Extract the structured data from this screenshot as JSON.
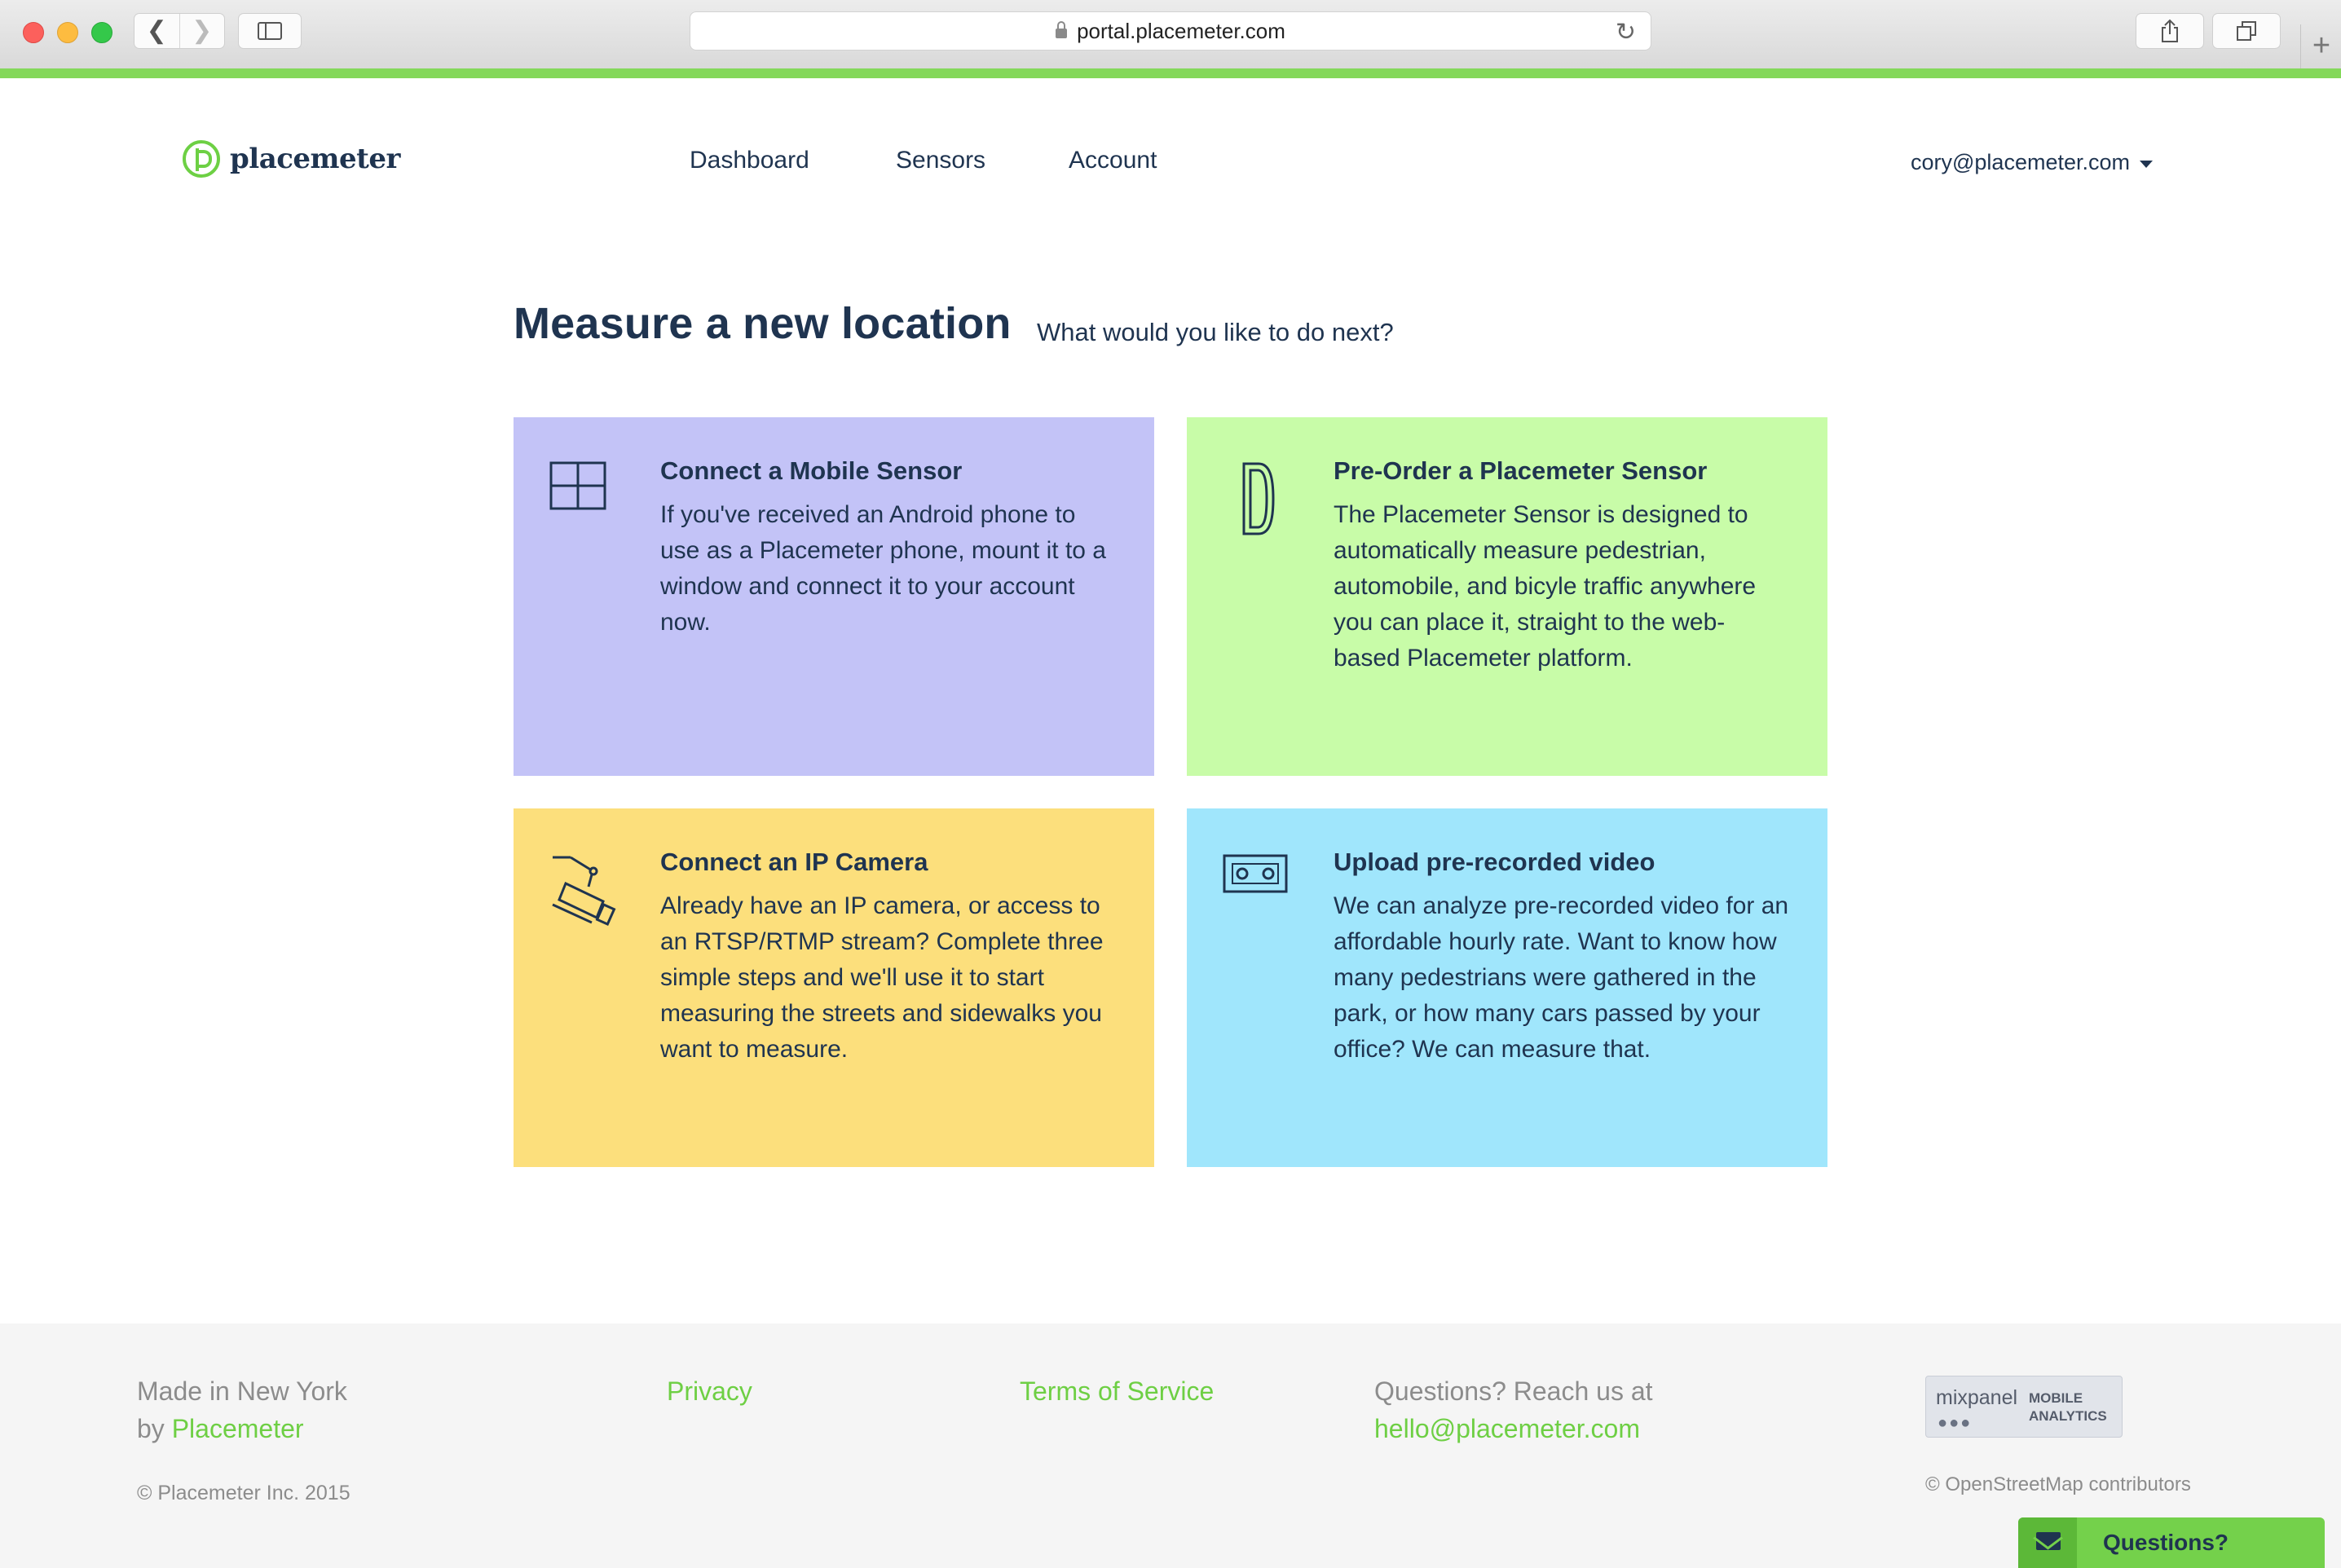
{
  "browser": {
    "url": "portal.placemeter.com",
    "back_glyph": "❮",
    "forward_glyph": "❯",
    "reload_glyph": "↻",
    "new_tab_glyph": "+"
  },
  "header": {
    "logo_text": "placemeter",
    "nav": [
      {
        "label": "Dashboard"
      },
      {
        "label": "Sensors"
      },
      {
        "label": "Account"
      }
    ],
    "user_email": "cory@placemeter.com"
  },
  "main": {
    "title": "Measure a new location",
    "subtitle": "What would you like to do next?",
    "cards": [
      {
        "title": "Connect a Mobile Sensor",
        "body": "If you've received an Android phone to use as a Placemeter phone, mount it to a window and connect it to your account now.",
        "color": "#c3c3f7",
        "icon": "window-icon"
      },
      {
        "title": "Pre-Order a Placemeter Sensor",
        "body": "The Placemeter Sensor is designed to automatically measure pedestrian, automobile, and bicyle traffic anywhere you can place it, straight to the web-based Placemeter platform.",
        "color": "#c8fca8",
        "icon": "sensor-device-icon"
      },
      {
        "title": "Connect an IP Camera",
        "body": "Already have an IP camera, or access to an RTSP/RTMP stream? Complete three simple steps and we'll use it to start measuring the streets and sidewalks you want to measure.",
        "color": "#fcdf7c",
        "icon": "security-camera-icon"
      },
      {
        "title": "Upload pre-recorded video",
        "body": "We can analyze pre-recorded video for an affordable hourly rate. Want to know how many pedestrians were gathered in the park, or how many cars passed by your office? We can measure that.",
        "color": "#a0e6fc",
        "icon": "video-cassette-icon"
      }
    ]
  },
  "footer": {
    "made_in": "Made in New York",
    "by": "by",
    "by_link": "Placemeter",
    "privacy": "Privacy",
    "terms": "Terms of Service",
    "questions_text": "Questions? Reach us at",
    "email": "hello@placemeter.com",
    "copyright": "© Placemeter Inc. 2015",
    "mixpanel_name": "mixpanel",
    "mixpanel_dots": "●●●",
    "mixpanel_tag_1": "MOBILE",
    "mixpanel_tag_2": "ANALYTICS",
    "osm": "© OpenStreetMap contributors"
  },
  "widget": {
    "questions_label": "Questions?"
  },
  "colors": {
    "brand_green": "#6ecf44",
    "progress_green": "#84d85a",
    "text_navy": "#1f3450"
  }
}
